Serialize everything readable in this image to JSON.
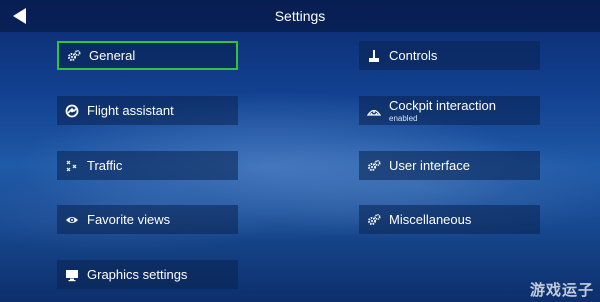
{
  "header": {
    "title": "Settings",
    "back_icon": "back-arrow-icon"
  },
  "left_menu": [
    {
      "label": "General",
      "icon": "gears-icon",
      "selected": true
    },
    {
      "label": "Flight assistant",
      "icon": "flight-assistant-icon"
    },
    {
      "label": "Traffic",
      "icon": "traffic-icon"
    },
    {
      "label": "Favorite views",
      "icon": "eye-icon"
    },
    {
      "label": "Graphics settings",
      "icon": "monitor-icon"
    }
  ],
  "right_menu": [
    {
      "label": "Controls",
      "icon": "joystick-icon"
    },
    {
      "label": "Cockpit interaction",
      "sublabel": "enabled",
      "icon": "cockpit-icon"
    },
    {
      "label": "User interface",
      "icon": "gears-icon"
    },
    {
      "label": "Miscellaneous",
      "icon": "gears-icon"
    }
  ],
  "watermark": "游戏运子",
  "colors": {
    "selected_border": "#2fc43b",
    "item_bg": "rgba(10,35,80,0.55)"
  }
}
